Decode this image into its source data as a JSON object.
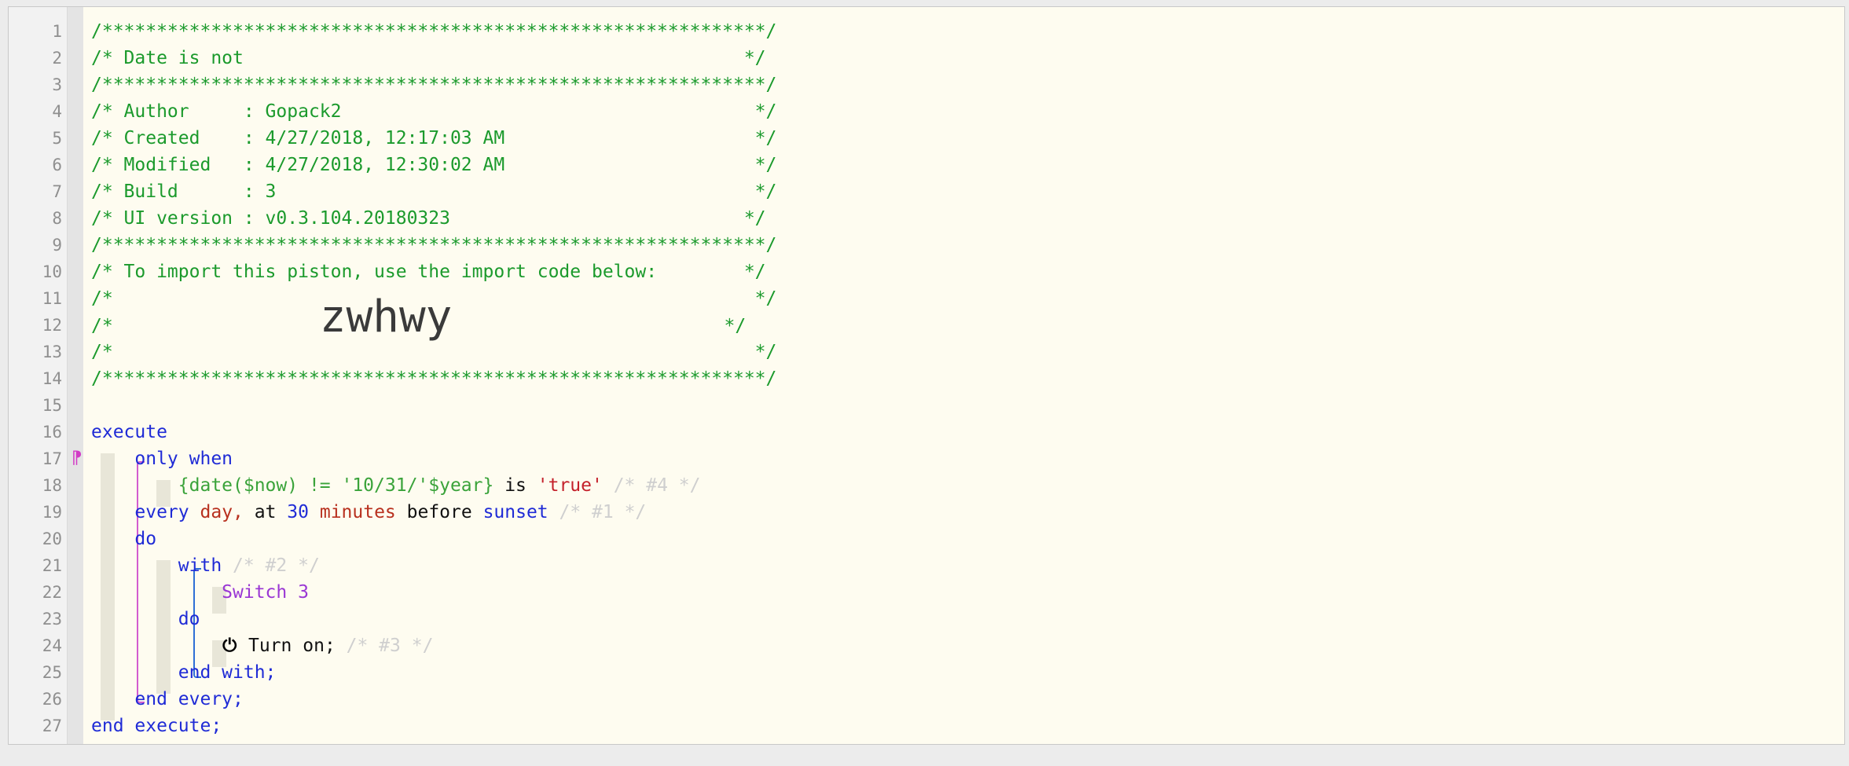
{
  "editor": {
    "gutter_marker": "⁋",
    "lines": [
      {
        "n": "1",
        "segments": [
          {
            "c": "cmt",
            "t": "/*************************************************************/"
          }
        ]
      },
      {
        "n": "2",
        "segments": [
          {
            "c": "cmt",
            "t": "/* Date is not                                              */"
          }
        ]
      },
      {
        "n": "3",
        "segments": [
          {
            "c": "cmt",
            "t": "/*************************************************************/"
          }
        ]
      },
      {
        "n": "4",
        "segments": [
          {
            "c": "cmt",
            "t": "/* Author     : Gopack2                                      */"
          }
        ]
      },
      {
        "n": "5",
        "segments": [
          {
            "c": "cmt",
            "t": "/* Created    : 4/27/2018, 12:17:03 AM                       */"
          }
        ]
      },
      {
        "n": "6",
        "segments": [
          {
            "c": "cmt",
            "t": "/* Modified   : 4/27/2018, 12:30:02 AM                       */"
          }
        ]
      },
      {
        "n": "7",
        "segments": [
          {
            "c": "cmt",
            "t": "/* Build      : 3                                            */"
          }
        ]
      },
      {
        "n": "8",
        "segments": [
          {
            "c": "cmt",
            "t": "/* UI version : v0.3.104.20180323                           */"
          }
        ]
      },
      {
        "n": "9",
        "segments": [
          {
            "c": "cmt",
            "t": "/*************************************************************/"
          }
        ]
      },
      {
        "n": "10",
        "segments": [
          {
            "c": "cmt",
            "t": "/* To import this piston, use the import code below:        */"
          }
        ]
      },
      {
        "n": "11",
        "segments": [
          {
            "c": "cmt",
            "t": "/*                                                           */"
          }
        ]
      },
      {
        "n": "12",
        "segments": [
          {
            "c": "cmt",
            "t": "/*                   "
          },
          {
            "c": "big",
            "t": "zwhwy"
          },
          {
            "c": "cmt",
            "t": "                         */"
          }
        ]
      },
      {
        "n": "13",
        "segments": [
          {
            "c": "cmt",
            "t": "/*                                                           */"
          }
        ]
      },
      {
        "n": "14",
        "segments": [
          {
            "c": "cmt",
            "t": "/*************************************************************/"
          }
        ]
      },
      {
        "n": "15",
        "segments": []
      },
      {
        "n": "16",
        "segments": [
          {
            "c": "kw",
            "t": "execute"
          }
        ]
      },
      {
        "n": "17",
        "segments": [
          {
            "c": "",
            "t": "    "
          },
          {
            "c": "kw",
            "t": "only when"
          }
        ]
      },
      {
        "n": "18",
        "segments": [
          {
            "c": "",
            "t": "        "
          },
          {
            "c": "expr",
            "t": "{date($now) != '10/31/'$year}"
          },
          {
            "c": "",
            "t": " is "
          },
          {
            "c": "str",
            "t": "'true'"
          },
          {
            "c": "cmt-dim",
            "t": " /* #4 */"
          }
        ]
      },
      {
        "n": "19",
        "segments": [
          {
            "c": "",
            "t": "    "
          },
          {
            "c": "kw",
            "t": "every"
          },
          {
            "c": "",
            "t": " "
          },
          {
            "c": "val",
            "t": "day,"
          },
          {
            "c": "",
            "t": " at "
          },
          {
            "c": "num",
            "t": "30"
          },
          {
            "c": "",
            "t": " "
          },
          {
            "c": "val",
            "t": "minutes"
          },
          {
            "c": "",
            "t": " before "
          },
          {
            "c": "kw",
            "t": "sunset"
          },
          {
            "c": "cmt-dim",
            "t": " /* #1 */"
          }
        ]
      },
      {
        "n": "20",
        "segments": [
          {
            "c": "",
            "t": "    "
          },
          {
            "c": "kw",
            "t": "do"
          }
        ]
      },
      {
        "n": "21",
        "segments": [
          {
            "c": "",
            "t": "        "
          },
          {
            "c": "kw",
            "t": "with"
          },
          {
            "c": "cmt-dim",
            "t": " /* #2 */"
          }
        ]
      },
      {
        "n": "22",
        "segments": [
          {
            "c": "",
            "t": "            "
          },
          {
            "c": "dev",
            "t": "Switch 3"
          }
        ]
      },
      {
        "n": "23",
        "segments": [
          {
            "c": "",
            "t": "        "
          },
          {
            "c": "kw",
            "t": "do"
          }
        ]
      },
      {
        "n": "24",
        "segments": [
          {
            "c": "",
            "t": "            "
          },
          {
            "c": "power",
            "t": "⏻"
          },
          {
            "c": "",
            "t": " Turn on;"
          },
          {
            "c": "cmt-dim",
            "t": " /* #3 */"
          }
        ]
      },
      {
        "n": "25",
        "segments": [
          {
            "c": "",
            "t": "        "
          },
          {
            "c": "kw",
            "t": "end with;"
          }
        ]
      },
      {
        "n": "26",
        "segments": [
          {
            "c": "",
            "t": "    "
          },
          {
            "c": "kw",
            "t": "end every;"
          }
        ]
      },
      {
        "n": "27",
        "segments": [
          {
            "c": "kw",
            "t": "end execute;"
          }
        ]
      }
    ]
  }
}
